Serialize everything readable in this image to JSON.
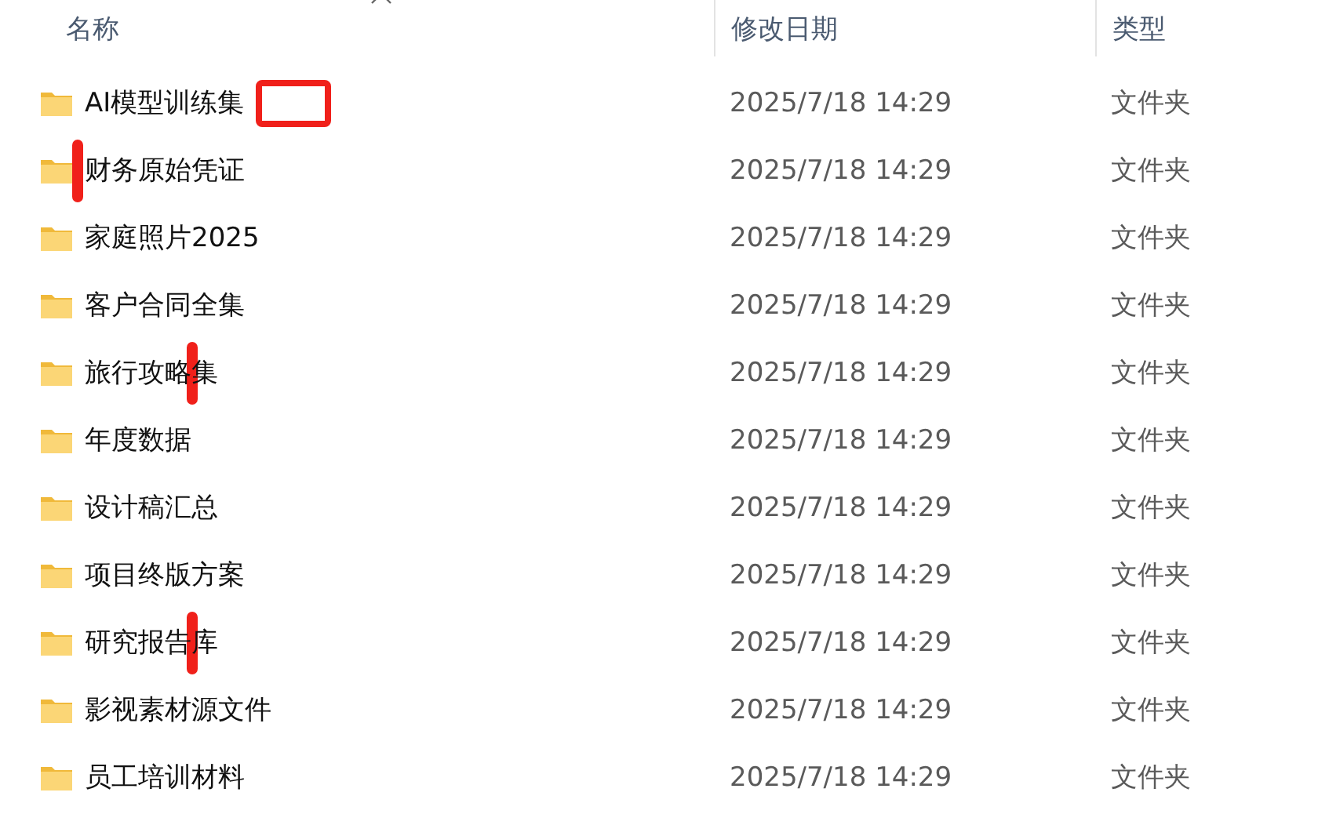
{
  "columns": [
    "名称",
    "修改日期",
    "类型"
  ],
  "rows": [
    {
      "name": "AI模型训练集",
      "modified": "2025/7/18 14:29",
      "type": "文件夹",
      "annotation": {
        "kind": "box-end"
      }
    },
    {
      "name": "财务原始凭证",
      "modified": "2025/7/18 14:29",
      "type": "文件夹",
      "annotation": {
        "kind": "bar-start"
      }
    },
    {
      "name": "家庭照片2025",
      "modified": "2025/7/18 14:29",
      "type": "文件夹"
    },
    {
      "name": "客户合同全集",
      "modified": "2025/7/18 14:29",
      "type": "文件夹"
    },
    {
      "name": "旅行攻略集",
      "modified": "2025/7/18 14:29",
      "type": "文件夹",
      "annotation": {
        "kind": "bar-inside"
      }
    },
    {
      "name": "年度数据",
      "modified": "2025/7/18 14:29",
      "type": "文件夹"
    },
    {
      "name": "设计稿汇总",
      "modified": "2025/7/18 14:29",
      "type": "文件夹"
    },
    {
      "name": "项目终版方案",
      "modified": "2025/7/18 14:29",
      "type": "文件夹"
    },
    {
      "name": "研究报告库",
      "modified": "2025/7/18 14:29",
      "type": "文件夹",
      "annotation": {
        "kind": "bar-inside"
      }
    },
    {
      "name": "影视素材源文件",
      "modified": "2025/7/18 14:29",
      "type": "文件夹"
    },
    {
      "name": "员工培训材料",
      "modified": "2025/7/18 14:29",
      "type": "文件夹"
    }
  ]
}
